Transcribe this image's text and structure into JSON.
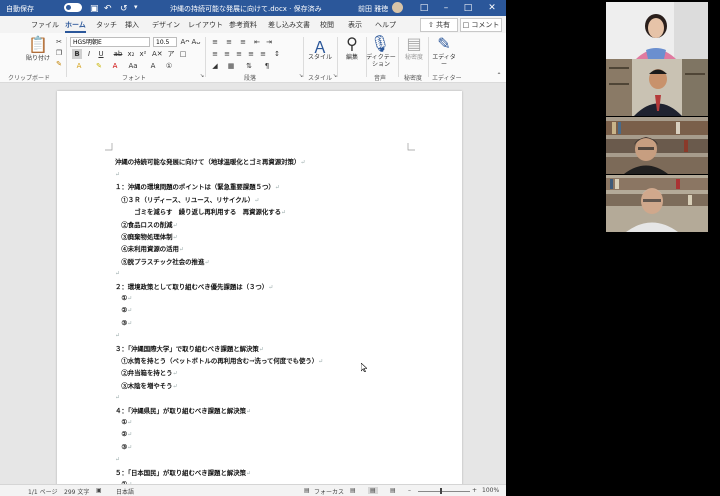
{
  "titlebar": {
    "autosave_label": "自動保存",
    "autosave_state": "オン",
    "document_title": "沖縄の持続可能な発展に向けて.docx · 保存済み",
    "user_name": "前田 雅徳"
  },
  "tabs": [
    "ファイル",
    "ホーム",
    "タッチ",
    "挿入",
    "デザイン",
    "レイアウト",
    "参考資料",
    "差し込み文書",
    "校閲",
    "表示",
    "ヘルプ"
  ],
  "active_tab": "ホーム",
  "share_label": "共有",
  "comment_label": "コメント",
  "ribbon": {
    "paste_label": "貼り付け",
    "font_name": "HGS明朝E",
    "font_size": "10.5",
    "groups": {
      "clipboard": "クリップボード",
      "font": "フォント",
      "paragraph": "段落",
      "styles": "スタイル",
      "voice": "音声",
      "sensitivity": "秘密度",
      "editor_group": "エディター"
    },
    "style_btn": "スタイル",
    "edit_btn": "編集",
    "dictate_btn": "ディクテーション",
    "sensitivity_btn": "秘密度",
    "editor_btn": "エディター"
  },
  "document": {
    "title": "沖縄の持続可能な発展に向けて（地球温暖化とゴミ再資源対策）",
    "lines": [
      {
        "text": "１：沖縄の環境問題のポイントは（緊急重要課題５つ）",
        "indent": 0,
        "gap": 2
      },
      {
        "text": "①３Ｒ（リディース、リユース、リサイクル）",
        "indent": 1,
        "gap": 0
      },
      {
        "text": "ゴミを減らす　繰り返し再利用する　再資源化する",
        "indent": 3,
        "gap": 0
      },
      {
        "text": "②食品ロスの削減",
        "indent": 1,
        "gap": 0
      },
      {
        "text": "③廃棄物処理体制",
        "indent": 1,
        "gap": 0
      },
      {
        "text": "④未利用資源の活用",
        "indent": 1,
        "gap": 0
      },
      {
        "text": "⑤脱プラスチック社会の推進",
        "indent": 1,
        "gap": 0
      },
      {
        "text": "２：環境政策として取り組むべき優先課題は（３つ）",
        "indent": 0,
        "gap": 2
      },
      {
        "text": "①",
        "indent": 1,
        "gap": 0
      },
      {
        "text": "②",
        "indent": 1,
        "gap": 0
      },
      {
        "text": "③",
        "indent": 1,
        "gap": 0
      },
      {
        "text": "３：「沖縄国際大学」で取り組むべき課題と解決策",
        "indent": 0,
        "gap": 2
      },
      {
        "text": "①水筒を持とう（ペットボトルの再利用含む→洗って何度でも使う）",
        "indent": 1,
        "gap": 0
      },
      {
        "text": "②弁当箱を持とう",
        "indent": 1,
        "gap": 0
      },
      {
        "text": "③木陰を増やそう",
        "indent": 1,
        "gap": 0
      },
      {
        "text": "４：「沖縄県民」が取り組むべき課題と解決策",
        "indent": 0,
        "gap": 2
      },
      {
        "text": "①",
        "indent": 1,
        "gap": 0
      },
      {
        "text": "②",
        "indent": 1,
        "gap": 0
      },
      {
        "text": "③",
        "indent": 1,
        "gap": 0
      },
      {
        "text": "５：「日本国民」が取り組むべき課題と解決策",
        "indent": 0,
        "gap": 2
      },
      {
        "text": "①",
        "indent": 1,
        "gap": 0
      }
    ]
  },
  "statusbar": {
    "page": "1/1 ページ",
    "words": "299 文字",
    "language": "日本語",
    "focus": "フォーカス",
    "zoom": "100%"
  },
  "colors": {
    "titlebar": "#2b579a",
    "accent": "#2b579a"
  }
}
